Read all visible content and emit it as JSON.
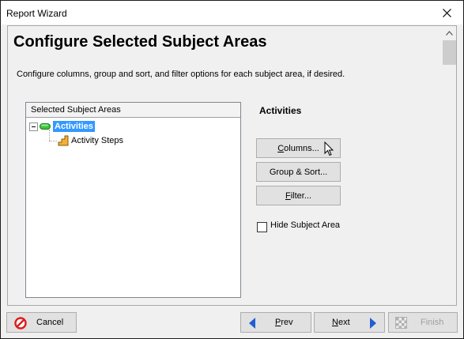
{
  "window": {
    "title": "Report Wizard",
    "close_glyph": "✕"
  },
  "page": {
    "heading": "Configure Selected Subject Areas",
    "description": "Configure columns, group and sort, and filter options for each subject area, if desired."
  },
  "tree": {
    "header": "Selected Subject Areas",
    "items": [
      {
        "label": "Activities",
        "icon": "green-pill-icon",
        "selected": true,
        "expanded": true
      },
      {
        "label": "Activity Steps",
        "icon": "steps-icon",
        "selected": false
      }
    ]
  },
  "subject_panel": {
    "title": "Activities",
    "buttons": {
      "columns_accel": "C",
      "columns_rest": "olumns...",
      "group_sort": "Group & Sort...",
      "filter_accel": "F",
      "filter_rest": "ilter..."
    },
    "hide_label": "Hide Subject Area",
    "hide_checked": false
  },
  "footer": {
    "cancel": "Cancel",
    "prev_accel": "P",
    "prev_rest": "rev",
    "next_accel": "N",
    "next_rest": "ext",
    "finish": "Finish",
    "finish_enabled": false
  },
  "colors": {
    "accent_selected": "#3399ff",
    "nav_arrow": "#1f5fd1",
    "cancel_red": "#e01b1b"
  }
}
